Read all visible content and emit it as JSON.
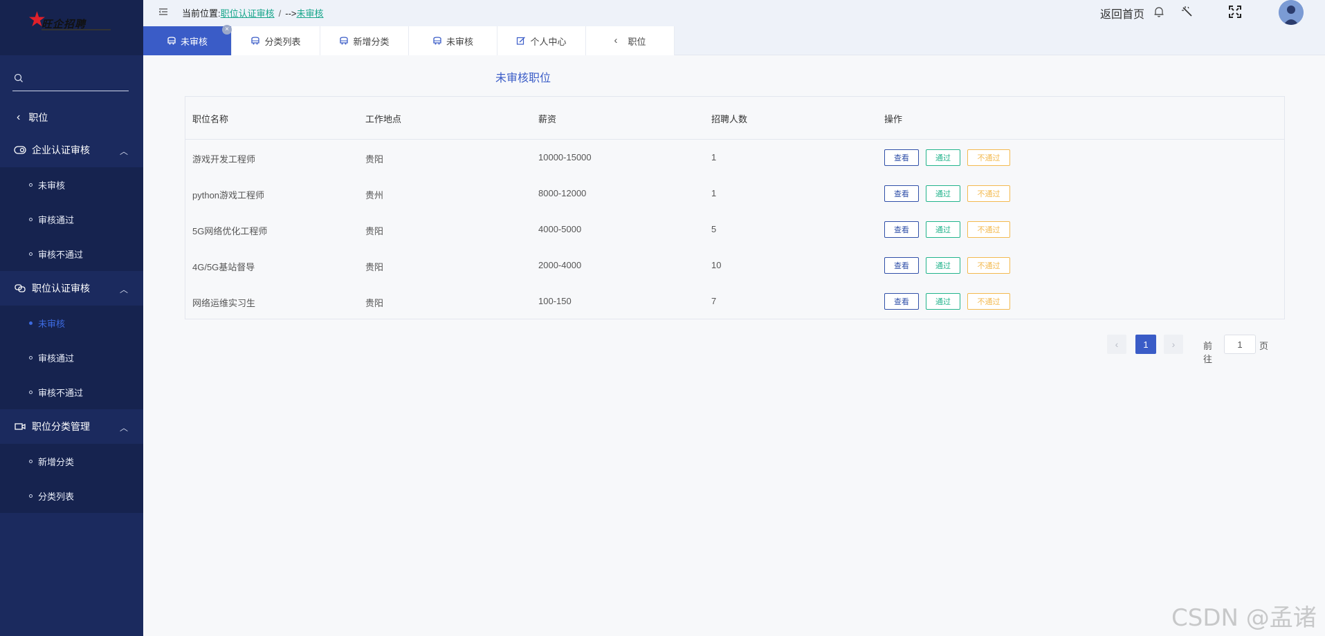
{
  "sidebar": {
    "logo_text": "旺企招聘",
    "search_placeholder": "",
    "back_label": "职位",
    "groups": [
      {
        "label": "企业认证审核",
        "items": [
          "未审核",
          "审核通过",
          "审核不通过"
        ]
      },
      {
        "label": "职位认证审核",
        "items": [
          "未审核",
          "审核通过",
          "审核不通过"
        ],
        "active_item": 0
      },
      {
        "label": "职位分类管理",
        "items": [
          "新增分类",
          "分类列表"
        ]
      }
    ]
  },
  "header": {
    "breadcrumb_prefix": "当前位置:",
    "breadcrumb_link": "职位认证审核",
    "breadcrumb_sep": "/",
    "breadcrumb_arrow": "-->",
    "breadcrumb_current": "未审核",
    "home_label": "返回首页"
  },
  "tabs": [
    {
      "label": "未审核",
      "active": true,
      "icon": "bus-icon"
    },
    {
      "label": "分类列表",
      "active": false,
      "icon": "bus-icon"
    },
    {
      "label": "新增分类",
      "active": false,
      "icon": "bus-icon"
    },
    {
      "label": "未审核",
      "active": false,
      "icon": "bus-icon"
    },
    {
      "label": "个人中心",
      "active": false,
      "icon": "edit-icon"
    },
    {
      "label": "职位",
      "active": false,
      "icon": "chevron-left-icon"
    }
  ],
  "main": {
    "title": "未审核职位",
    "columns": [
      "职位名称",
      "工作地点",
      "薪资",
      "招聘人数",
      "操作"
    ],
    "rows": [
      {
        "name": "游戏开发工程师",
        "location": "贵阳",
        "salary": "10000-15000",
        "count": "1"
      },
      {
        "name": "python游戏工程师",
        "location": "贵州",
        "salary": "8000-12000",
        "count": "1"
      },
      {
        "name": "5G网络优化工程师",
        "location": "贵阳",
        "salary": "4000-5000",
        "count": "5"
      },
      {
        "name": "4G/5G基站督导",
        "location": "贵阳",
        "salary": "2000-4000",
        "count": "10"
      },
      {
        "name": "网络运维实习生",
        "location": "贵阳",
        "salary": "100-150",
        "count": "7"
      }
    ],
    "actions": {
      "view": "查看",
      "pass": "通过",
      "reject": "不通过"
    }
  },
  "pagination": {
    "current_page": "1",
    "goto_label": "前往",
    "page_input": "1",
    "page_suffix": "页"
  },
  "watermark": "CSDN @孟诸",
  "colors": {
    "sidebar_bg": "#1b2a5e",
    "accent": "#3a5cc7",
    "pass": "#21b38b",
    "reject": "#f3b94e"
  }
}
